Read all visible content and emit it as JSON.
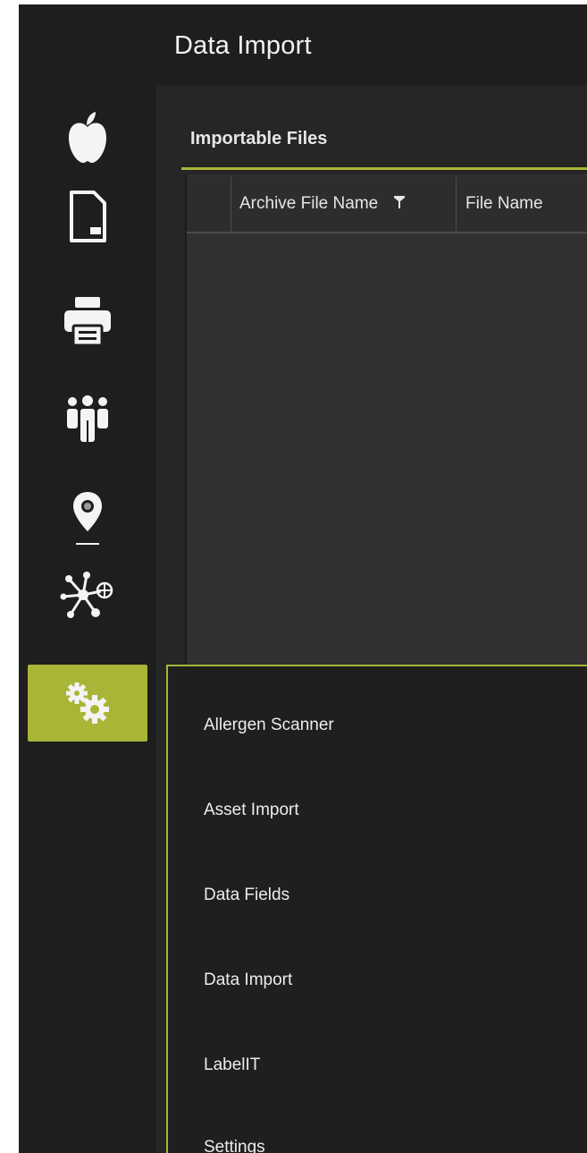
{
  "window": {
    "title": "Data Import"
  },
  "sidebar": {
    "items": [
      {
        "icon": "apple-icon",
        "active": false
      },
      {
        "icon": "label-file-icon",
        "active": false
      },
      {
        "icon": "printer-icon",
        "active": false
      },
      {
        "icon": "users-icon",
        "active": false
      },
      {
        "icon": "location-pin-icon",
        "active": false
      },
      {
        "icon": "network-icon",
        "active": false
      },
      {
        "icon": "gears-icon",
        "active": true
      }
    ]
  },
  "panel": {
    "title": "Importable Files",
    "columns": [
      "Archive File Name",
      "File Name"
    ]
  },
  "menu": {
    "items": [
      "Allergen Scanner",
      "Asset Import",
      "Data Fields",
      "Data Import",
      "LabelIT",
      "Settings"
    ]
  },
  "colors": {
    "accent": "#a9b536",
    "background": "#1e1e1e",
    "panel": "#262626"
  }
}
